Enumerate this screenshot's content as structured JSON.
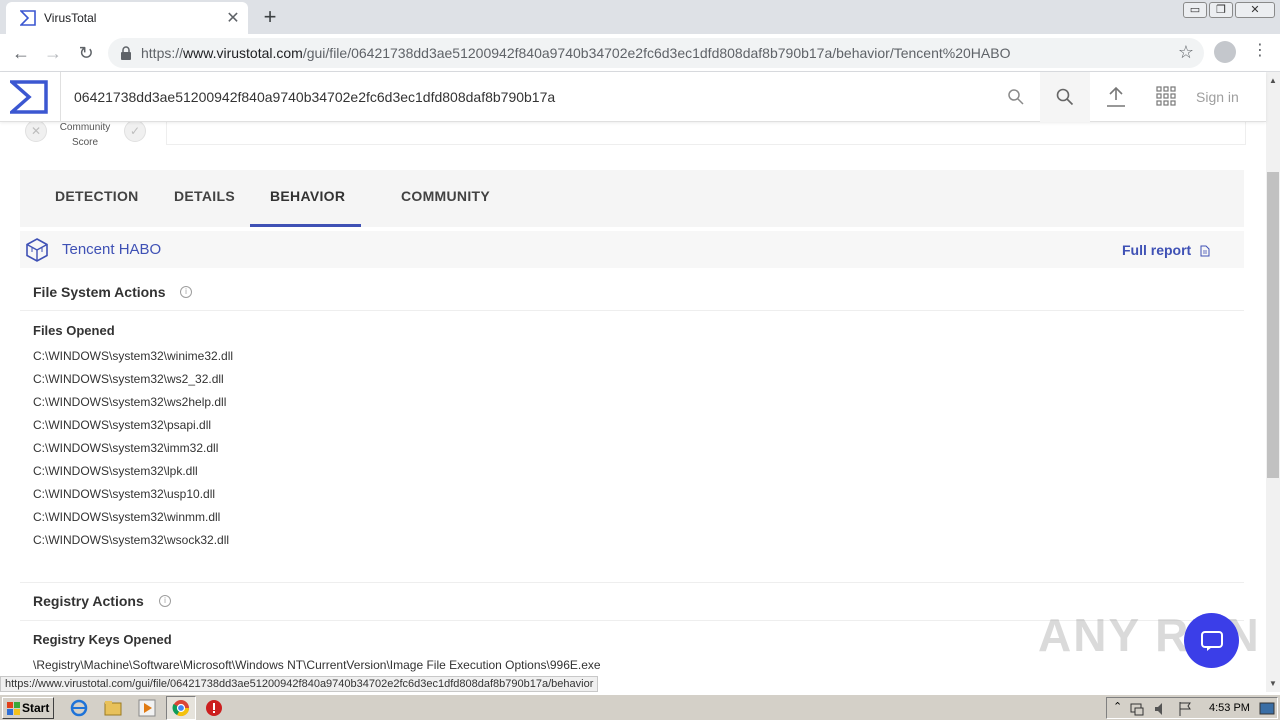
{
  "browser": {
    "tab_title": "VirusTotal",
    "tab_close": "✕",
    "new_tab": "+",
    "url_prefix": "https://",
    "url_domain": "www.virustotal.com",
    "url_path": "/gui/file/06421738dd3ae51200942f840a9740b34702e2fc6d3ec1dfd808daf8b790b17a/behavior/Tencent%20HABO",
    "back_icon": "←",
    "forward_icon": "→",
    "reload_icon": "↻",
    "star_icon": "☆",
    "menu_icon": "⋮",
    "window_buttons": [
      "▭",
      "❐",
      "✕"
    ]
  },
  "vt_header": {
    "search_value": "06421738dd3ae51200942f840a9740b34702e2fc6d3ec1dfd808daf8b790b17a",
    "sign_in": "Sign in"
  },
  "community": {
    "label_line1": "Community",
    "label_line2": "Score",
    "down_icon": "✕",
    "up_icon": "✓"
  },
  "tabs": [
    {
      "label": "DETECTION",
      "active": false
    },
    {
      "label": "DETAILS",
      "active": false
    },
    {
      "label": "BEHAVIOR",
      "active": true
    },
    {
      "label": "COMMUNITY",
      "active": false
    }
  ],
  "sandbox": {
    "name": "Tencent HABO",
    "full_report": "Full report"
  },
  "file_system": {
    "title": "File System Actions",
    "info_icon": "i",
    "files_opened_title": "Files Opened",
    "files_opened": [
      "C:\\WINDOWS\\system32\\winime32.dll",
      "C:\\WINDOWS\\system32\\ws2_32.dll",
      "C:\\WINDOWS\\system32\\ws2help.dll",
      "C:\\WINDOWS\\system32\\psapi.dll",
      "C:\\WINDOWS\\system32\\imm32.dll",
      "C:\\WINDOWS\\system32\\lpk.dll",
      "C:\\WINDOWS\\system32\\usp10.dll",
      "C:\\WINDOWS\\system32\\winmm.dll",
      "C:\\WINDOWS\\system32\\wsock32.dll"
    ]
  },
  "registry": {
    "title": "Registry Actions",
    "info_icon": "i",
    "keys_opened_title": "Registry Keys Opened",
    "keys_opened": [
      "\\Registry\\Machine\\Software\\Microsoft\\Windows NT\\CurrentVersion\\Image File Execution Options\\996E.exe"
    ]
  },
  "status_bar": "https://www.virustotal.com/gui/file/06421738dd3ae51200942f840a9740b34702e2fc6d3ec1dfd808daf8b790b17a/behavior",
  "watermark": "ANY RUN",
  "taskbar": {
    "start_label": "Start",
    "clock": "4:53 PM"
  },
  "colors": {
    "accent": "#3f51b5",
    "chat_button": "#3b3ee8"
  }
}
